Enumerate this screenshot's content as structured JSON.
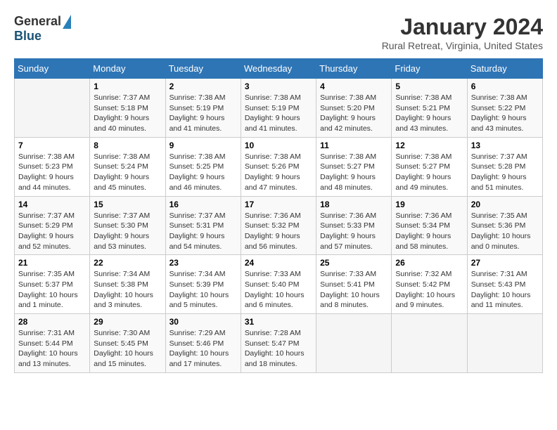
{
  "header": {
    "logo_general": "General",
    "logo_blue": "Blue",
    "month_title": "January 2024",
    "location": "Rural Retreat, Virginia, United States"
  },
  "weekdays": [
    "Sunday",
    "Monday",
    "Tuesday",
    "Wednesday",
    "Thursday",
    "Friday",
    "Saturday"
  ],
  "weeks": [
    [
      {
        "day": "",
        "info": ""
      },
      {
        "day": "1",
        "info": "Sunrise: 7:37 AM\nSunset: 5:18 PM\nDaylight: 9 hours\nand 40 minutes."
      },
      {
        "day": "2",
        "info": "Sunrise: 7:38 AM\nSunset: 5:19 PM\nDaylight: 9 hours\nand 41 minutes."
      },
      {
        "day": "3",
        "info": "Sunrise: 7:38 AM\nSunset: 5:19 PM\nDaylight: 9 hours\nand 41 minutes."
      },
      {
        "day": "4",
        "info": "Sunrise: 7:38 AM\nSunset: 5:20 PM\nDaylight: 9 hours\nand 42 minutes."
      },
      {
        "day": "5",
        "info": "Sunrise: 7:38 AM\nSunset: 5:21 PM\nDaylight: 9 hours\nand 43 minutes."
      },
      {
        "day": "6",
        "info": "Sunrise: 7:38 AM\nSunset: 5:22 PM\nDaylight: 9 hours\nand 43 minutes."
      }
    ],
    [
      {
        "day": "7",
        "info": "Sunrise: 7:38 AM\nSunset: 5:23 PM\nDaylight: 9 hours\nand 44 minutes."
      },
      {
        "day": "8",
        "info": "Sunrise: 7:38 AM\nSunset: 5:24 PM\nDaylight: 9 hours\nand 45 minutes."
      },
      {
        "day": "9",
        "info": "Sunrise: 7:38 AM\nSunset: 5:25 PM\nDaylight: 9 hours\nand 46 minutes."
      },
      {
        "day": "10",
        "info": "Sunrise: 7:38 AM\nSunset: 5:26 PM\nDaylight: 9 hours\nand 47 minutes."
      },
      {
        "day": "11",
        "info": "Sunrise: 7:38 AM\nSunset: 5:27 PM\nDaylight: 9 hours\nand 48 minutes."
      },
      {
        "day": "12",
        "info": "Sunrise: 7:38 AM\nSunset: 5:27 PM\nDaylight: 9 hours\nand 49 minutes."
      },
      {
        "day": "13",
        "info": "Sunrise: 7:37 AM\nSunset: 5:28 PM\nDaylight: 9 hours\nand 51 minutes."
      }
    ],
    [
      {
        "day": "14",
        "info": "Sunrise: 7:37 AM\nSunset: 5:29 PM\nDaylight: 9 hours\nand 52 minutes."
      },
      {
        "day": "15",
        "info": "Sunrise: 7:37 AM\nSunset: 5:30 PM\nDaylight: 9 hours\nand 53 minutes."
      },
      {
        "day": "16",
        "info": "Sunrise: 7:37 AM\nSunset: 5:31 PM\nDaylight: 9 hours\nand 54 minutes."
      },
      {
        "day": "17",
        "info": "Sunrise: 7:36 AM\nSunset: 5:32 PM\nDaylight: 9 hours\nand 56 minutes."
      },
      {
        "day": "18",
        "info": "Sunrise: 7:36 AM\nSunset: 5:33 PM\nDaylight: 9 hours\nand 57 minutes."
      },
      {
        "day": "19",
        "info": "Sunrise: 7:36 AM\nSunset: 5:34 PM\nDaylight: 9 hours\nand 58 minutes."
      },
      {
        "day": "20",
        "info": "Sunrise: 7:35 AM\nSunset: 5:36 PM\nDaylight: 10 hours\nand 0 minutes."
      }
    ],
    [
      {
        "day": "21",
        "info": "Sunrise: 7:35 AM\nSunset: 5:37 PM\nDaylight: 10 hours\nand 1 minute."
      },
      {
        "day": "22",
        "info": "Sunrise: 7:34 AM\nSunset: 5:38 PM\nDaylight: 10 hours\nand 3 minutes."
      },
      {
        "day": "23",
        "info": "Sunrise: 7:34 AM\nSunset: 5:39 PM\nDaylight: 10 hours\nand 5 minutes."
      },
      {
        "day": "24",
        "info": "Sunrise: 7:33 AM\nSunset: 5:40 PM\nDaylight: 10 hours\nand 6 minutes."
      },
      {
        "day": "25",
        "info": "Sunrise: 7:33 AM\nSunset: 5:41 PM\nDaylight: 10 hours\nand 8 minutes."
      },
      {
        "day": "26",
        "info": "Sunrise: 7:32 AM\nSunset: 5:42 PM\nDaylight: 10 hours\nand 9 minutes."
      },
      {
        "day": "27",
        "info": "Sunrise: 7:31 AM\nSunset: 5:43 PM\nDaylight: 10 hours\nand 11 minutes."
      }
    ],
    [
      {
        "day": "28",
        "info": "Sunrise: 7:31 AM\nSunset: 5:44 PM\nDaylight: 10 hours\nand 13 minutes."
      },
      {
        "day": "29",
        "info": "Sunrise: 7:30 AM\nSunset: 5:45 PM\nDaylight: 10 hours\nand 15 minutes."
      },
      {
        "day": "30",
        "info": "Sunrise: 7:29 AM\nSunset: 5:46 PM\nDaylight: 10 hours\nand 17 minutes."
      },
      {
        "day": "31",
        "info": "Sunrise: 7:28 AM\nSunset: 5:47 PM\nDaylight: 10 hours\nand 18 minutes."
      },
      {
        "day": "",
        "info": ""
      },
      {
        "day": "",
        "info": ""
      },
      {
        "day": "",
        "info": ""
      }
    ]
  ]
}
